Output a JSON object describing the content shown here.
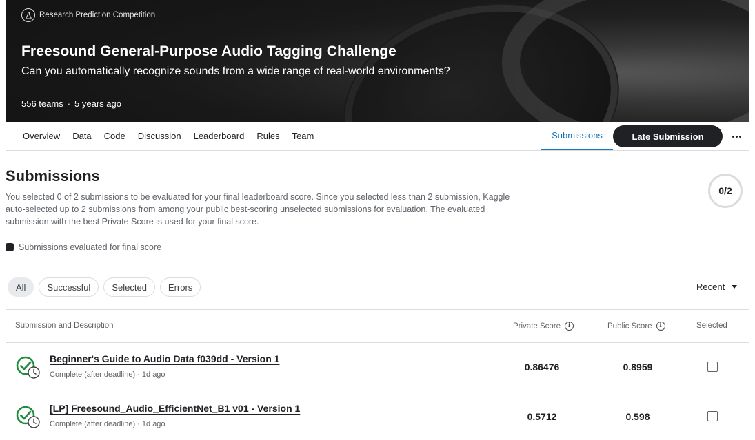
{
  "banner": {
    "competition_type": "Research Prediction Competition",
    "title": "Freesound General-Purpose Audio Tagging Challenge",
    "subtitle": "Can you automatically recognize sounds from a wide range of real-world environments?",
    "teams": "556 teams",
    "separator": "·",
    "age": "5 years ago"
  },
  "nav": {
    "items": [
      "Overview",
      "Data",
      "Code",
      "Discussion",
      "Leaderboard",
      "Rules",
      "Team"
    ],
    "submissions_tab": "Submissions",
    "late_submission_button": "Late Submission",
    "more_icon": "more-horizontal-icon"
  },
  "page": {
    "title": "Submissions",
    "description": "You selected 0 of 2 submissions to be evaluated for your final leaderboard score. Since you selected less than 2 submission, Kaggle auto-selected up to 2 submissions from among your public best-scoring unselected submissions for evaluation. The evaluated submission with the best Private Score is used for your final score.",
    "selection_counter": "0/2",
    "legend_text": "Submissions evaluated for final score"
  },
  "filters": {
    "chips": [
      "All",
      "Successful",
      "Selected",
      "Errors"
    ],
    "active": "All",
    "sort_label": "Recent"
  },
  "table": {
    "headers": {
      "submission": "Submission and Description",
      "private": "Private Score",
      "public": "Public Score",
      "selected": "Selected"
    },
    "rows": [
      {
        "title": "Beginner's Guide to Audio Data f039dd - Version 1",
        "meta": "Complete (after deadline) · 1d ago",
        "private_score": "0.86476",
        "public_score": "0.8959",
        "selected": false
      },
      {
        "title": "[LP] Freesound_Audio_EfficientNet_B1 v01 - Version 1",
        "meta": "Complete (after deadline) · 1d ago",
        "private_score": "0.5712",
        "public_score": "0.598",
        "selected": false
      }
    ]
  },
  "colors": {
    "accent": "#1a73b8",
    "success": "#1e8e3e",
    "dark": "#202124"
  }
}
